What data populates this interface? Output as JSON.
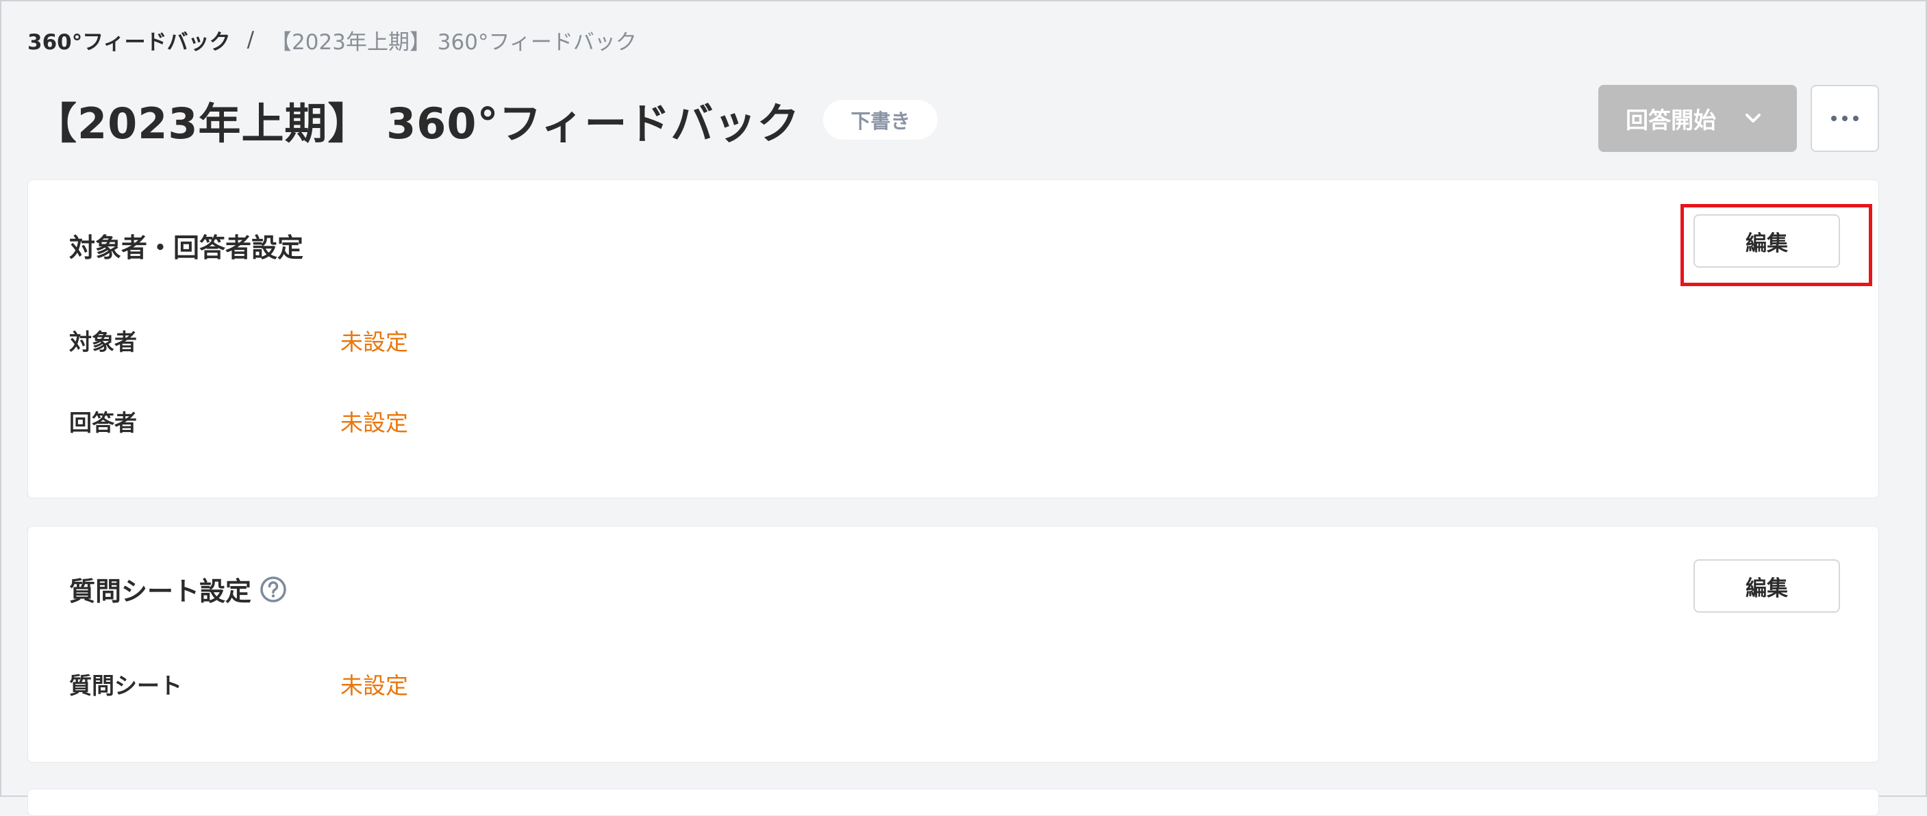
{
  "breadcrumb": {
    "root": "360°フィードバック",
    "separator": "/",
    "current": "【2023年上期】 360°フィードバック"
  },
  "header": {
    "title": "【2023年上期】 360°フィードバック",
    "status_badge": "下書き",
    "start_button": "回答開始",
    "more_icon": "more-horizontal-icon"
  },
  "section_targets": {
    "title": "対象者・回答者設定",
    "edit_label": "編集",
    "rows": [
      {
        "label": "対象者",
        "value": "未設定"
      },
      {
        "label": "回答者",
        "value": "未設定"
      }
    ]
  },
  "section_questions": {
    "title": "質問シート設定",
    "help_icon": "question-circle-icon",
    "edit_label": "編集",
    "rows": [
      {
        "label": "質問シート",
        "value": "未設定"
      }
    ]
  },
  "colors": {
    "unset_value": "#e8770d",
    "highlight": "#e8141b",
    "disabled_button": "#bdbdbd"
  }
}
